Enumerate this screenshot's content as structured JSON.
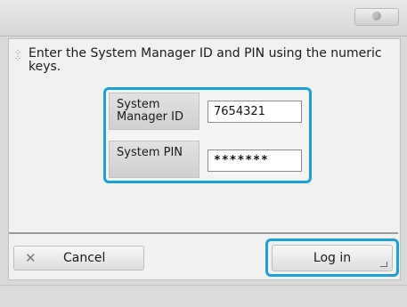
{
  "dialog": {
    "message": "Enter the System Manager ID and PIN using the numeric keys.",
    "fields": {
      "manager_id": {
        "label": "System Manager ID",
        "value": "7654321"
      },
      "pin": {
        "label": "System PIN",
        "value": "*******"
      }
    },
    "buttons": {
      "cancel": "Cancel",
      "login": "Log in"
    }
  },
  "icons": {
    "top_right": "eco-status-icon",
    "message": "keypad-icon",
    "cancel": "close-icon"
  },
  "colors": {
    "focus_accent": "#1aa0dc"
  }
}
